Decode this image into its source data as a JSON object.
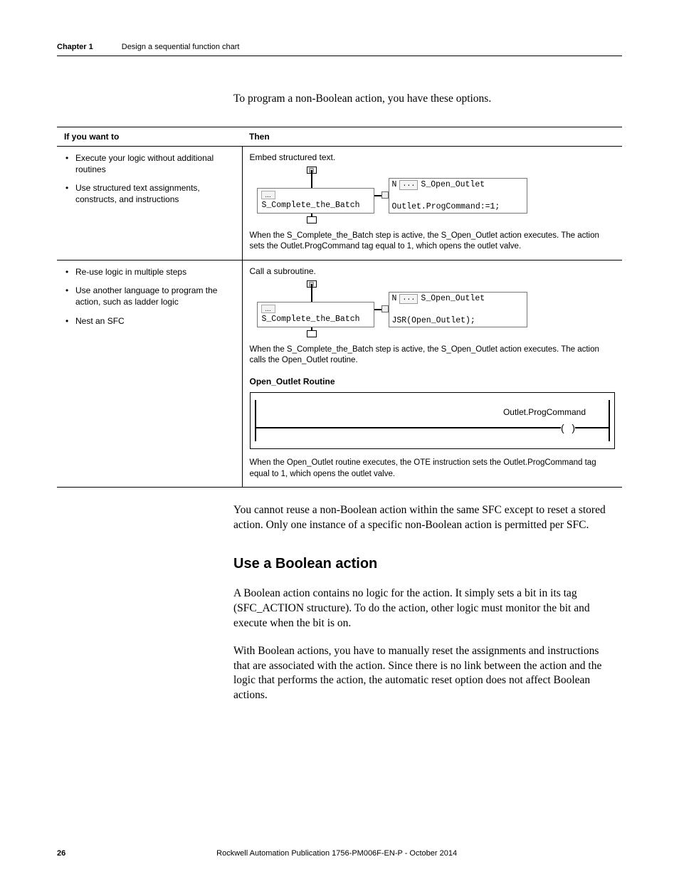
{
  "header": {
    "chapter": "Chapter 1",
    "title": "Design a sequential function chart"
  },
  "intro": "To program a non-Boolean action, you have these options.",
  "table": {
    "headers": {
      "left": "If you want to",
      "right": "Then"
    },
    "rows": [
      {
        "left_bullets": [
          "Execute your logic without additional routines",
          "Use structured text assignments, constructs, and instructions"
        ],
        "then_intro": "Embed structured text.",
        "diagram": {
          "step_name": "S_Complete_the_Batch",
          "action_qualifier": "N",
          "action_name": "S_Open_Outlet",
          "action_body": "Outlet.ProgCommand:=1;"
        },
        "explain": "When the S_Complete_the_Batch step is active, the S_Open_Outlet action executes. The action sets the Outlet.ProgCommand tag equal to 1, which opens the outlet valve."
      },
      {
        "left_bullets": [
          "Re-use logic in multiple steps",
          "Use another language to program the action, such as ladder logic",
          "Nest an SFC"
        ],
        "then_intro": "Call a subroutine.",
        "diagram": {
          "step_name": "S_Complete_the_Batch",
          "action_qualifier": "N",
          "action_name": "S_Open_Outlet",
          "action_body": "JSR(Open_Outlet);"
        },
        "explain": "When the S_Complete_the_Batch step is active, the S_Open_Outlet action executes. The action calls the Open_Outlet routine.",
        "routine_heading": "Open_Outlet Routine",
        "ladder_label": "Outlet.ProgCommand",
        "routine_explain": "When the Open_Outlet routine executes, the OTE instruction sets the Outlet.ProgCommand tag equal to 1, which opens the outlet valve."
      }
    ]
  },
  "after_table": "You cannot reuse a non-Boolean action within the same SFC except to reset a stored action. Only one instance of a specific non-Boolean action is permitted per SFC.",
  "section": {
    "heading": "Use a Boolean action",
    "p1": "A Boolean action contains no logic for the action. It simply sets a bit in its tag (SFC_ACTION structure). To do the action, other logic must monitor the bit and execute when the bit is on.",
    "p2": "With Boolean actions, you have to manually reset the assignments and instructions that are associated with the action. Since there is no link between the action and the logic that performs the action, the automatic reset option does not affect Boolean actions."
  },
  "footer": {
    "page": "26",
    "publication": "Rockwell Automation Publication 1756-PM006F-EN-P - October 2014"
  }
}
